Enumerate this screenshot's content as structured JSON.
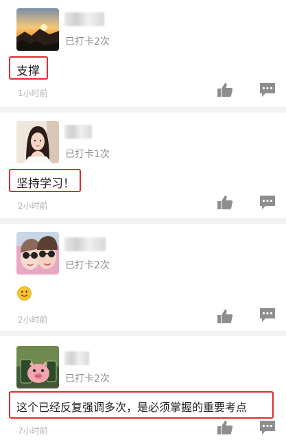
{
  "posts": [
    {
      "checkin": "已打卡2次",
      "content": "支撑",
      "time": "1小时前",
      "avatar": "avatar-mountain-sunrise"
    },
    {
      "checkin": "已打卡1次",
      "content": "坚持学习！",
      "time": "2小时前",
      "avatar": "avatar-woman-portrait"
    },
    {
      "checkin": "已打卡2次",
      "content": "",
      "emoji": "slightly-smiling-face-icon",
      "time": "2小时前",
      "avatar": "avatar-selfie-sunglasses"
    },
    {
      "checkin": "已打卡2次",
      "content": "这个已经反复强调多次，是必须掌握的重要考点",
      "time": "7小时前",
      "avatar": "avatar-pig-toy"
    }
  ],
  "colors": {
    "highlight": "#e52a2a",
    "icon": "#8e8e8e",
    "meta": "#8a8a8a",
    "time": "#b0b0b0"
  },
  "icons": [
    "thumbs-up-icon",
    "comment-bubble-icon"
  ]
}
